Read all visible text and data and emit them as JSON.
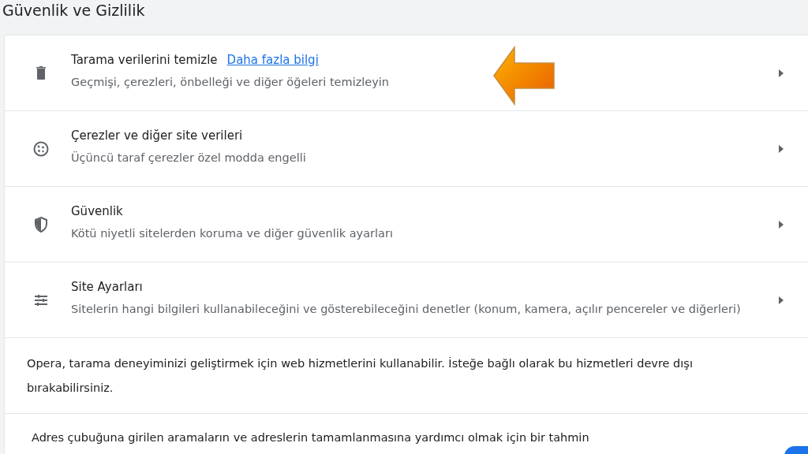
{
  "section_title": "Güvenlik ve Gizlilik",
  "rows": [
    {
      "kind": "nav",
      "title": "Tarama verilerini temizle",
      "link": "Daha fazla bilgi",
      "description": "Geçmişi, çerezleri, önbelleği ve diğer öğeleri temizleyin"
    },
    {
      "kind": "nav",
      "title": "Çerezler ve diğer site verileri",
      "description": "Üçüncü taraf çerezler özel modda engelli"
    },
    {
      "kind": "nav",
      "title": "Güvenlik",
      "description": "Kötü niyetli sitelerden koruma ve diğer güvenlik ayarları"
    },
    {
      "kind": "nav",
      "title": "Site Ayarları",
      "description": "Sitelerin hangi bilgileri kullanabileceğini ve gösterebileceğini denetler (konum, kamera, açılır pencereler ve diğerleri)"
    },
    {
      "kind": "info",
      "description": "Opera, tarama deneyiminizi geliştirmek için web hizmetlerini kullanabilir. İsteğe bağlı olarak bu hizmetleri devre dışı bırakabilirsiniz."
    },
    {
      "kind": "toggle",
      "description": "Adres çubuğuna girilen aramaların ve adreslerin tamamlanmasına yardımcı olmak için bir tahmin",
      "on": true
    }
  ]
}
